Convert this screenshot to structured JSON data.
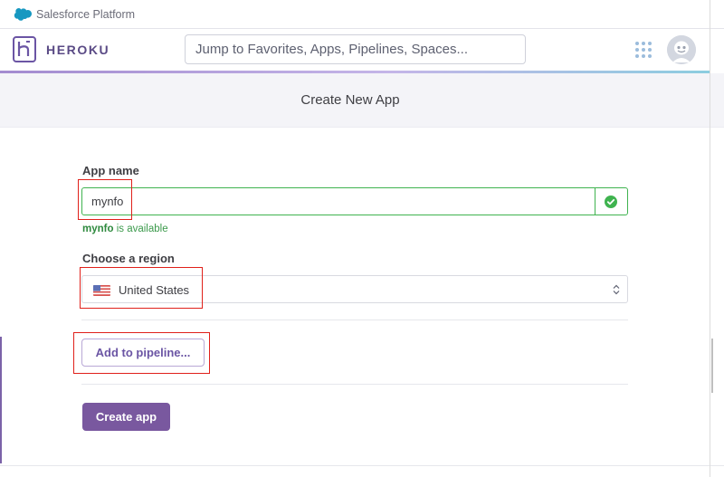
{
  "salesforce_bar": {
    "label": "Salesforce Platform",
    "icon": "salesforce-cloud-icon",
    "color": "#1798c1"
  },
  "nav": {
    "brand": "HEROKU",
    "brand_color": "#5a4a85",
    "search_placeholder": "Jump to Favorites, Apps, Pipelines, Spaces...",
    "apps_icon": "apps-grid-icon",
    "avatar_icon": "user-avatar-icon"
  },
  "page": {
    "title": "Create New App"
  },
  "form": {
    "app_name_label": "App name",
    "app_name_value": "mynfo",
    "availability_name": "mynfo",
    "availability_text": " is available",
    "region_label": "Choose a region",
    "region_value": "United States",
    "pipeline_button": "Add to pipeline...",
    "create_button": "Create app"
  },
  "colors": {
    "accent": "#79589f",
    "success": "#3fb34f",
    "annotation": "#e0201a"
  }
}
